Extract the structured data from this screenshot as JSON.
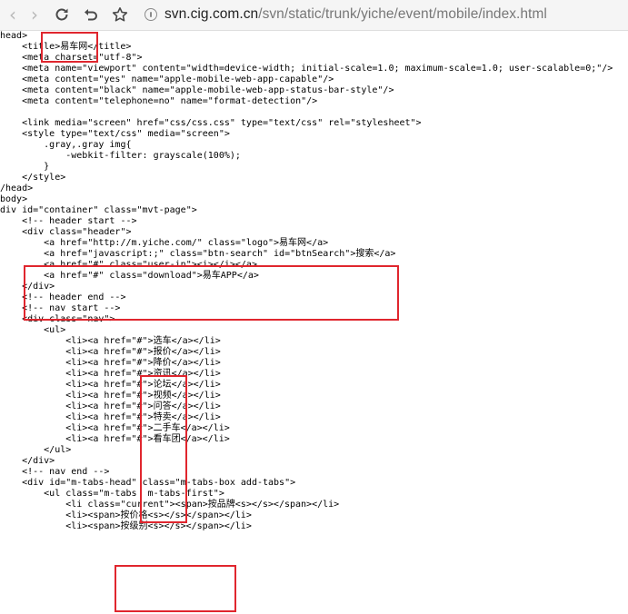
{
  "browser": {
    "url_host": "svn.cig.com.cn",
    "url_path": "/svn/static/trunk/yiche/event/mobile/index.html"
  },
  "source_lines": [
    "head>",
    "    <title>易车网</title>",
    "    <meta charset=\"utf-8\">",
    "    <meta name=\"viewport\" content=\"width=device-width; initial-scale=1.0; maximum-scale=1.0; user-scalable=0;\"/>",
    "    <meta content=\"yes\" name=\"apple-mobile-web-app-capable\"/>",
    "    <meta content=\"black\" name=\"apple-mobile-web-app-status-bar-style\"/>",
    "    <meta content=\"telephone=no\" name=\"format-detection\"/>",
    "",
    "    <link media=\"screen\" href=\"css/css.css\" type=\"text/css\" rel=\"stylesheet\">",
    "    <style type=\"text/css\" media=\"screen\">",
    "        .gray,.gray img{",
    "            -webkit-filter: grayscale(100%);",
    "        }",
    "    </style>",
    "/head>",
    "body>",
    "div id=\"container\" class=\"mvt-page\">",
    "    <!-- header start -->",
    "    <div class=\"header\">",
    "        <a href=\"http://m.yiche.com/\" class=\"logo\">易车网</a>",
    "        <a href=\"javascript:;\" class=\"btn-search\" id=\"btnSearch\">搜索</a>",
    "        <a href=\"#\" class=\"user-in\"><i></i></a>",
    "        <a href=\"#\" class=\"download\">易车APP</a>",
    "    </div>",
    "    <!-- header end -->",
    "    <!-- nav start -->",
    "    <div class=\"nav\">",
    "        <ul>",
    "            <li><a href=\"#\">选车</a></li>",
    "            <li><a href=\"#\">报价</a></li>",
    "            <li><a href=\"#\">降价</a></li>",
    "            <li><a href=\"#\">资讯</a></li>",
    "            <li><a href=\"#\">论坛</a></li>",
    "            <li><a href=\"#\">视频</a></li>",
    "            <li><a href=\"#\">问答</a></li>",
    "            <li><a href=\"#\">特卖</a></li>",
    "            <li><a href=\"#\">二手车</a></li>",
    "            <li><a href=\"#\">看车团</a></li>",
    "        </ul>",
    "    </div>",
    "    <!-- nav end -->",
    "    <div id=\"m-tabs-head\" class=\"m-tabs-box add-tabs\">",
    "        <ul class=\"m-tabs  m-tabs-first\">",
    "            <li class=\"current\"><span>按品牌<s></s></span></li>",
    "            <li><span>按价格<s></s></span></li>",
    "            <li><span>按级别<s></s></span></li>"
  ]
}
